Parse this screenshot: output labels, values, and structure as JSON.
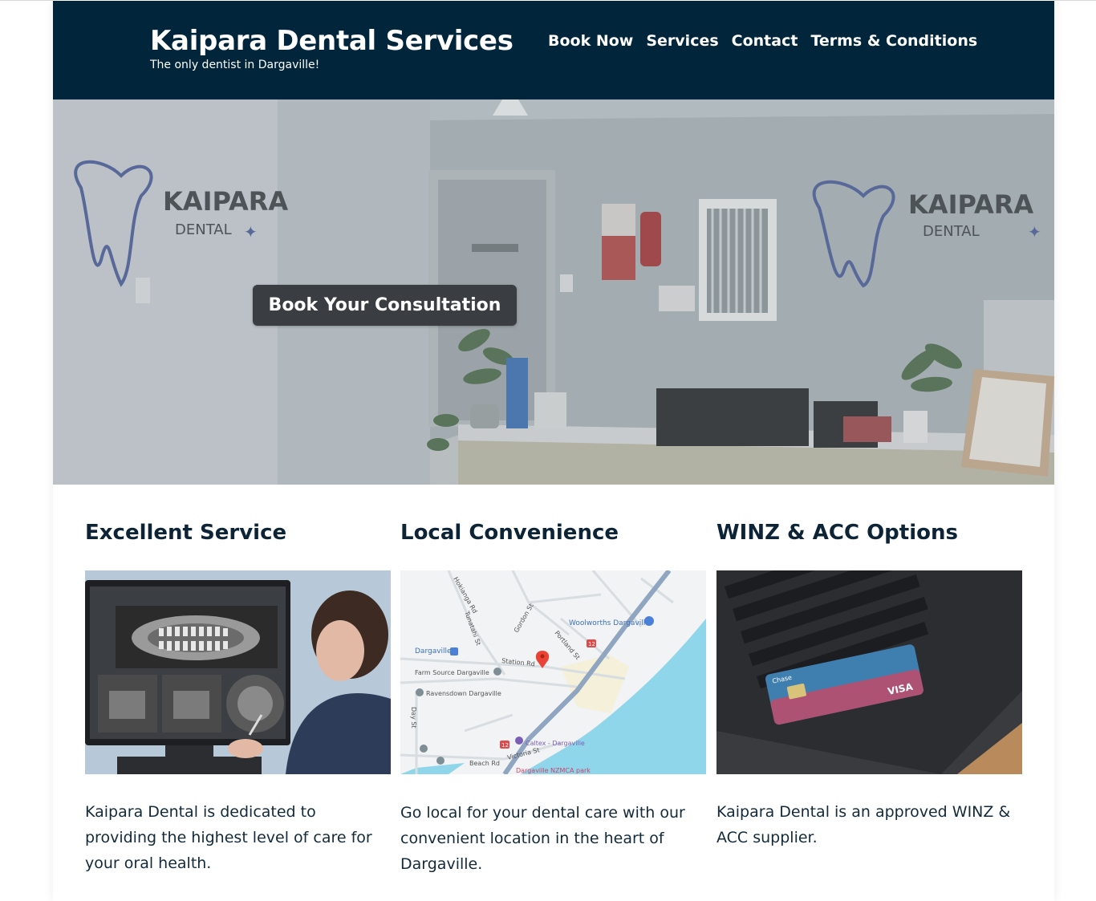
{
  "header": {
    "title": "Kaipara Dental Services",
    "tagline": "The only dentist in Dargaville!",
    "nav": [
      {
        "label": "Book Now"
      },
      {
        "label": "Services"
      },
      {
        "label": "Contact"
      },
      {
        "label": "Terms & Conditions"
      }
    ]
  },
  "hero": {
    "cta_label": "Book Your Consultation",
    "wall_logo_line1": "KAIPARA",
    "wall_logo_line2": "DENTAL"
  },
  "features": [
    {
      "title": "Excellent Service",
      "image_icon": "dental-xray-monitor-image",
      "text": "Kaipara Dental is dedicated to providing the highest level of care for your oral health."
    },
    {
      "title": "Local Convenience",
      "image_icon": "map-image",
      "text": "Go local for your dental care with our convenient location in the heart of Dargaville."
    },
    {
      "title": "WINZ & ACC Options",
      "image_icon": "credit-card-laptop-image",
      "text": "Kaipara Dental is an approved WINZ & ACC supplier."
    }
  ],
  "map": {
    "labels": {
      "woolworths": "Woolworths Dargaville",
      "dargaville": "Dargaville",
      "station_rd": "Station Rd",
      "farm_source": "Farm Source Dargaville",
      "ravensdown": "Ravensdown Dargaville",
      "caltex": "Caltex - Dargaville",
      "beach_rd": "Beach Rd",
      "victoria_st": "Victoria St",
      "nzmca": "Dargaville NZMCA park",
      "hokianga": "Hokianga Rd",
      "tunatahi": "Tunatahi St",
      "gordon": "Gordon St",
      "portland": "Portland St",
      "day_st": "Day St",
      "route_12": "12"
    }
  },
  "card": {
    "brand": "VISA",
    "bank": "Chase"
  },
  "colors": {
    "header_bg": "#01253b",
    "cta_bg": "#3a3d41",
    "heading": "#0c2435",
    "water": "#8fd6ea"
  }
}
